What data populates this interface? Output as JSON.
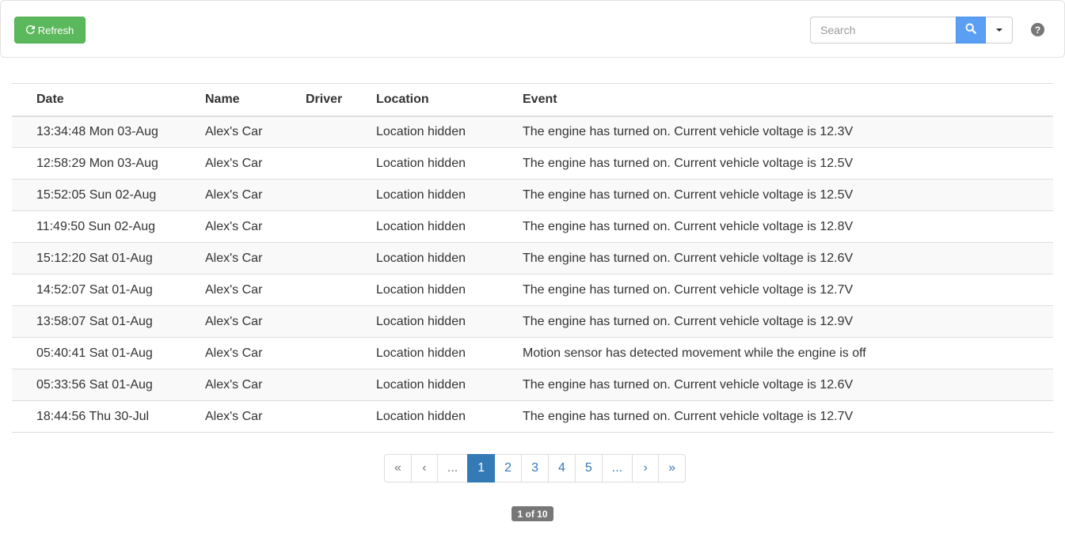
{
  "toolbar": {
    "refresh_label": "Refresh",
    "refresh_icon": "refresh-icon",
    "search_placeholder": "Search",
    "search_icon": "search-icon",
    "dropdown_icon": "caret-down-icon",
    "help_icon": "question-circle-icon",
    "help_glyph": "?"
  },
  "table": {
    "columns": [
      "Date",
      "Name",
      "Driver",
      "Location",
      "Event"
    ],
    "rows": [
      {
        "date": "13:34:48 Mon 03-Aug",
        "name": "Alex's Car",
        "driver": "",
        "location": "Location hidden",
        "event": "The engine has turned on. Current vehicle voltage is 12.3V"
      },
      {
        "date": "12:58:29 Mon 03-Aug",
        "name": "Alex's Car",
        "driver": "",
        "location": "Location hidden",
        "event": "The engine has turned on. Current vehicle voltage is 12.5V"
      },
      {
        "date": "15:52:05 Sun 02-Aug",
        "name": "Alex's Car",
        "driver": "",
        "location": "Location hidden",
        "event": "The engine has turned on. Current vehicle voltage is 12.5V"
      },
      {
        "date": "11:49:50 Sun 02-Aug",
        "name": "Alex's Car",
        "driver": "",
        "location": "Location hidden",
        "event": "The engine has turned on. Current vehicle voltage is 12.8V"
      },
      {
        "date": "15:12:20 Sat 01-Aug",
        "name": "Alex's Car",
        "driver": "",
        "location": "Location hidden",
        "event": "The engine has turned on. Current vehicle voltage is 12.6V"
      },
      {
        "date": "14:52:07 Sat 01-Aug",
        "name": "Alex's Car",
        "driver": "",
        "location": "Location hidden",
        "event": "The engine has turned on. Current vehicle voltage is 12.7V"
      },
      {
        "date": "13:58:07 Sat 01-Aug",
        "name": "Alex's Car",
        "driver": "",
        "location": "Location hidden",
        "event": "The engine has turned on. Current vehicle voltage is 12.9V"
      },
      {
        "date": "05:40:41 Sat 01-Aug",
        "name": "Alex's Car",
        "driver": "",
        "location": "Location hidden",
        "event": "Motion sensor has detected movement while the engine is off"
      },
      {
        "date": "05:33:56 Sat 01-Aug",
        "name": "Alex's Car",
        "driver": "",
        "location": "Location hidden",
        "event": "The engine has turned on. Current vehicle voltage is 12.6V"
      },
      {
        "date": "18:44:56 Thu 30-Jul",
        "name": "Alex's Car",
        "driver": "",
        "location": "Location hidden",
        "event": "The engine has turned on. Current vehicle voltage is 12.7V"
      }
    ]
  },
  "pagination": {
    "items": [
      {
        "label": "«",
        "name": "first-page-button",
        "state": "muted"
      },
      {
        "label": "‹",
        "name": "prev-page-button",
        "state": "muted"
      },
      {
        "label": "...",
        "name": "ellipsis-start",
        "state": "muted"
      },
      {
        "label": "1",
        "name": "page-1-button",
        "state": "active"
      },
      {
        "label": "2",
        "name": "page-2-button",
        "state": ""
      },
      {
        "label": "3",
        "name": "page-3-button",
        "state": ""
      },
      {
        "label": "4",
        "name": "page-4-button",
        "state": ""
      },
      {
        "label": "5",
        "name": "page-5-button",
        "state": ""
      },
      {
        "label": "...",
        "name": "ellipsis-end",
        "state": ""
      },
      {
        "label": "›",
        "name": "next-page-button",
        "state": ""
      },
      {
        "label": "»",
        "name": "last-page-button",
        "state": ""
      }
    ],
    "page_status": "1 of 10"
  },
  "colors": {
    "refresh_button": "#5cb85c",
    "search_button": "#5b9ff5",
    "active_page": "#337ab7",
    "badge": "#777777"
  }
}
